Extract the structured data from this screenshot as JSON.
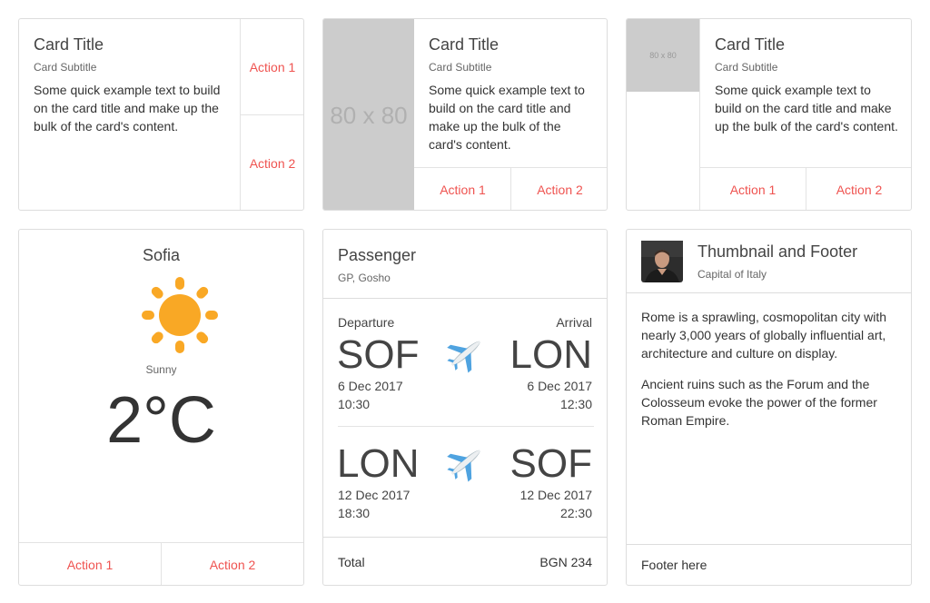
{
  "card1": {
    "title": "Card Title",
    "subtitle": "Card Subtitle",
    "text": "Some quick example text to build on the card title and make up the bulk of the card's content.",
    "action1": "Action 1",
    "action2": "Action 2"
  },
  "card2": {
    "placeholder": "80 x 80",
    "title": "Card Title",
    "subtitle": "Card Subtitle",
    "text": "Some quick example text to build on the card title and make up the bulk of the card's content.",
    "action1": "Action 1",
    "action2": "Action 2"
  },
  "card3": {
    "placeholder": "80 x 80",
    "title": "Card Title",
    "subtitle": "Card Subtitle",
    "text": "Some quick example text to build on the card title and make up the bulk of the card's content.",
    "action1": "Action 1",
    "action2": "Action 2"
  },
  "weather": {
    "city": "Sofia",
    "icon": "sun-icon",
    "condition": "Sunny",
    "temperature": "2°C",
    "action1": "Action 1",
    "action2": "Action 2"
  },
  "flight": {
    "title": "Passenger",
    "subtitle": "GP, Gosho",
    "departure_label": "Departure",
    "arrival_label": "Arrival",
    "leg1": {
      "from": "SOF",
      "to": "LON",
      "dep_date": "6 Dec 2017",
      "dep_time": "10:30",
      "arr_date": "6 Dec 2017",
      "arr_time": "12:30",
      "icon": "airplane-icon"
    },
    "leg2": {
      "from": "LON",
      "to": "SOF",
      "dep_date": "12 Dec 2017",
      "dep_time": "18:30",
      "arr_date": "12 Dec 2017",
      "arr_time": "22:30",
      "icon": "airplane-icon"
    },
    "total_label": "Total",
    "total_value": "BGN 234"
  },
  "thumb": {
    "title": "Thumbnail and Footer",
    "subtitle": "Capital of Italy",
    "para1": "Rome is a sprawling, cosmopolitan city with nearly 3,000 years of globally influential art, architecture and culture on display.",
    "para2": "Ancient ruins such as the Forum and the Colosseum evoke the power of the former Roman Empire.",
    "footer": "Footer here"
  },
  "colors": {
    "accent": "#ef5350",
    "sun": "#f9a825",
    "border": "#dddddd",
    "placeholder": "#cccccc"
  }
}
